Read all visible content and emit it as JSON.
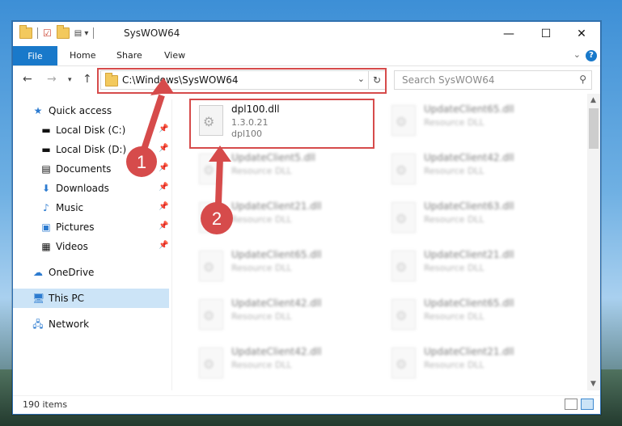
{
  "window": {
    "title": "SysWOW64"
  },
  "ribbon": {
    "file": "File",
    "tabs": [
      "Home",
      "Share",
      "View"
    ],
    "help": "?"
  },
  "nav": {
    "address": "C:\\Windows\\SysWOW64",
    "search_placeholder": "Search SysWOW64"
  },
  "sidebar": {
    "items": [
      {
        "label": "Quick access",
        "icon": "star-icon",
        "pinned": false
      },
      {
        "label": "Local Disk (C:)",
        "icon": "drive-icon",
        "pinned": true
      },
      {
        "label": "Local Disk (D:)",
        "icon": "drive-icon",
        "pinned": true
      },
      {
        "label": "Documents",
        "icon": "documents-icon",
        "pinned": true
      },
      {
        "label": "Downloads",
        "icon": "download-icon",
        "pinned": true
      },
      {
        "label": "Music",
        "icon": "music-icon",
        "pinned": true
      },
      {
        "label": "Pictures",
        "icon": "pictures-icon",
        "pinned": true
      },
      {
        "label": "Videos",
        "icon": "videos-icon",
        "pinned": true
      },
      {
        "label": "OneDrive",
        "icon": "cloud-icon",
        "pinned": false
      },
      {
        "label": "This PC",
        "icon": "computer-icon",
        "pinned": false
      },
      {
        "label": "Network",
        "icon": "network-icon",
        "pinned": false
      }
    ]
  },
  "files": [
    {
      "name": "dpl100.dll",
      "type": "1.3.0.21",
      "desc": "dpl100"
    },
    {
      "name": "UpdateClient65.dll",
      "type": "Resource DLL"
    },
    {
      "name": "UpdateClient5.dll",
      "type": "Resource DLL"
    },
    {
      "name": "UpdateClient42.dll",
      "type": "Resource DLL"
    },
    {
      "name": "UpdateClient21.dll",
      "type": "Resource DLL"
    },
    {
      "name": "UpdateClient63.dll",
      "type": "Resource DLL"
    },
    {
      "name": "UpdateClient65.dll",
      "type": "Resource DLL"
    },
    {
      "name": "UpdateClient21.dll",
      "type": "Resource DLL"
    },
    {
      "name": "UpdateClient42.dll",
      "type": "Resource DLL"
    },
    {
      "name": "UpdateClient65.dll",
      "type": "Resource DLL"
    },
    {
      "name": "UpdateClient42.dll",
      "type": "Resource DLL"
    },
    {
      "name": "UpdateClient21.dll",
      "type": "Resource DLL"
    }
  ],
  "status": {
    "count": "190 items"
  },
  "annotations": {
    "step1": "1",
    "step2": "2",
    "color": "#d64b4b"
  }
}
